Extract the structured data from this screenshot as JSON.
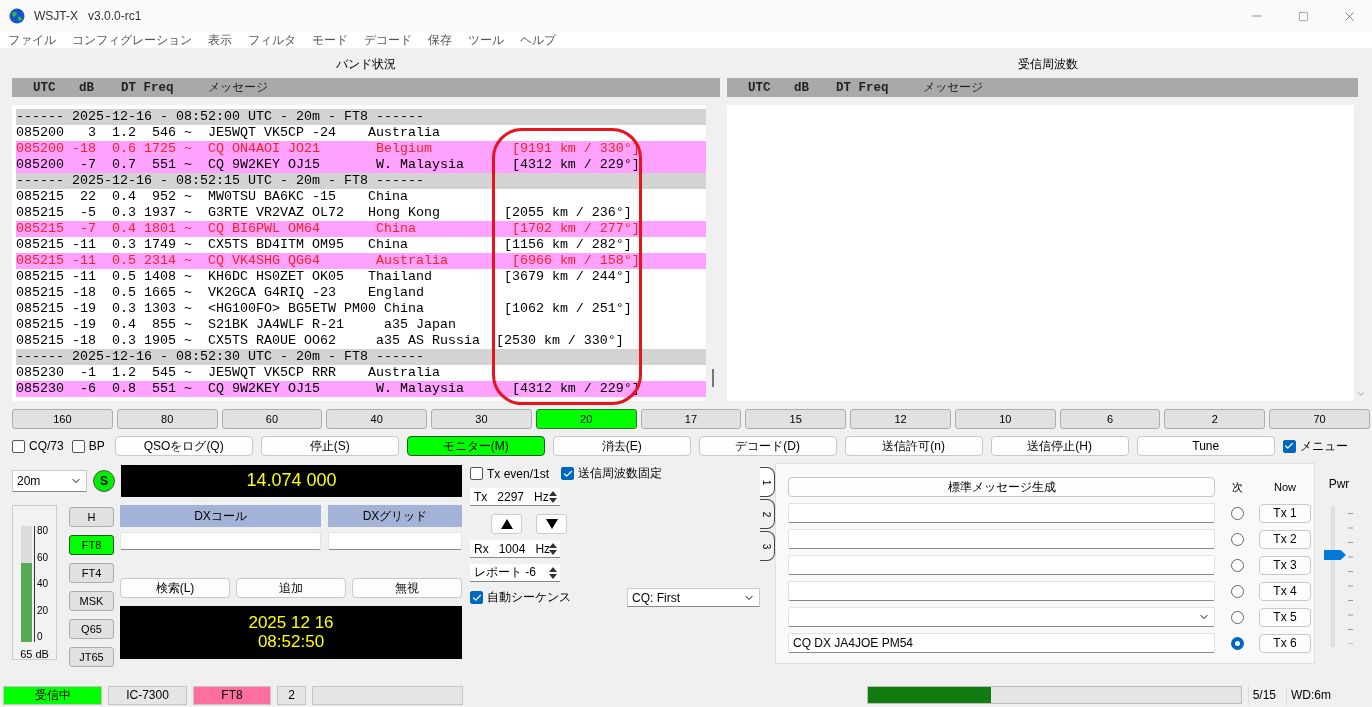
{
  "window": {
    "title": "WSJT-X   v3.0.0-rc1"
  },
  "menu": [
    "ファイル",
    "コンフィグレーション",
    "表示",
    "フィルタ",
    "モード",
    "デコード",
    "保存",
    "ツール",
    "ヘルプ"
  ],
  "band_activity": {
    "title": "バンド状況",
    "columns": [
      "UTC",
      "dB",
      "DT Freq",
      "メッセージ"
    ],
    "rows": [
      {
        "kind": "separator",
        "text": "------ 2025-12-16 - 08:52:00 UTC - 20m - FT8 ------"
      },
      {
        "kind": "decode",
        "text": "085200   3  1.2  546 ~  JE5WQT VK5CP -24    Australia",
        "highlighted": false,
        "alert": false
      },
      {
        "kind": "decode",
        "text": "085200 -18  0.6 1725 ~  CQ ON4AOI JO21       Belgium          [9191 km / 330°]",
        "highlighted": true,
        "alert": true
      },
      {
        "kind": "decode",
        "text": "085200  -7  0.7  551 ~  CQ 9W2KEY OJ15       W. Malaysia      [4312 km / 229°]",
        "highlighted": true,
        "alert": false
      },
      {
        "kind": "separator",
        "text": "------ 2025-12-16 - 08:52:15 UTC - 20m - FT8 ------"
      },
      {
        "kind": "decode",
        "text": "085215  22  0.4  952 ~  MW0TSU BA6KC -15    China",
        "highlighted": false,
        "alert": false
      },
      {
        "kind": "decode",
        "text": "085215  -5  0.3 1937 ~  G3RTE VR2VAZ OL72   Hong Kong        [2055 km / 236°]",
        "highlighted": false,
        "alert": false
      },
      {
        "kind": "decode",
        "text": "085215  -7  0.4 1801 ~  CQ BI6PWL OM64       China            [1702 km / 277°]",
        "highlighted": true,
        "alert": true
      },
      {
        "kind": "decode",
        "text": "085215 -11  0.3 1749 ~  CX5TS BD4ITM OM95   China            [1156 km / 282°]",
        "highlighted": false,
        "alert": false
      },
      {
        "kind": "decode",
        "text": "085215 -11  0.5 2314 ~  CQ VK4SHG QG64       Australia        [6966 km / 158°]",
        "highlighted": true,
        "alert": true
      },
      {
        "kind": "decode",
        "text": "085215 -11  0.5 1408 ~  KH6DC HS0ZET OK05   Thailand         [3679 km / 244°]",
        "highlighted": false,
        "alert": false
      },
      {
        "kind": "decode",
        "text": "085215 -18  0.5 1665 ~  VK2GCA G4RIQ -23    England",
        "highlighted": false,
        "alert": false
      },
      {
        "kind": "decode",
        "text": "085215 -19  0.3 1303 ~  <HG100FO> BG5ETW PM00 China          [1062 km / 251°]",
        "highlighted": false,
        "alert": false
      },
      {
        "kind": "decode",
        "text": "085215 -19  0.4  855 ~  S21BK JA4WLF R-21     a35 Japan",
        "highlighted": false,
        "alert": false
      },
      {
        "kind": "decode",
        "text": "085215 -18  0.3 1905 ~  CX5TS RA0UE OO62     a35 AS Russia  [2530 km / 330°]",
        "highlighted": false,
        "alert": false
      },
      {
        "kind": "separator",
        "text": "------ 2025-12-16 - 08:52:30 UTC - 20m - FT8 ------"
      },
      {
        "kind": "decode",
        "text": "085230  -1  1.2  545 ~  JE5WQT VK5CP RRR    Australia",
        "highlighted": false,
        "alert": false
      },
      {
        "kind": "decode",
        "text": "085230  -6  0.8  551 ~  CQ 9W2KEY OJ15       W. Malaysia      [4312 km / 229°]",
        "highlighted": true,
        "alert": false
      }
    ]
  },
  "rx_frequency": {
    "title": "受信周波数",
    "columns": [
      "UTC",
      "dB",
      "DT Freq",
      "メッセージ"
    ]
  },
  "bands": [
    {
      "label": "160",
      "selected": false
    },
    {
      "label": "80",
      "selected": false
    },
    {
      "label": "60",
      "selected": false
    },
    {
      "label": "40",
      "selected": false
    },
    {
      "label": "30",
      "selected": false
    },
    {
      "label": "20",
      "selected": true
    },
    {
      "label": "17",
      "selected": false
    },
    {
      "label": "15",
      "selected": false
    },
    {
      "label": "12",
      "selected": false
    },
    {
      "label": "10",
      "selected": false
    },
    {
      "label": "6",
      "selected": false
    },
    {
      "label": "2",
      "selected": false
    },
    {
      "label": "70",
      "selected": false
    }
  ],
  "controls": {
    "options": [
      {
        "label": "CQ/73",
        "checked": false
      },
      {
        "label": "BP",
        "checked": false
      }
    ],
    "buttons": [
      {
        "label": "QSOをログ(Q)",
        "active": false
      },
      {
        "label": "停止(S)",
        "active": false
      },
      {
        "label": "モニター(M)",
        "active": true
      },
      {
        "label": "消去(E)",
        "active": false
      },
      {
        "label": "デコード(D)",
        "active": false
      },
      {
        "label": "送信許可(n)",
        "active": false
      },
      {
        "label": "送信停止(H)",
        "active": false
      },
      {
        "label": "Tune",
        "active": false
      }
    ],
    "menu_toggle": {
      "label": "メニュー",
      "checked": true
    }
  },
  "band_select": {
    "value": "20m"
  },
  "sync_button": {
    "label": "S",
    "on": true
  },
  "frequency": "14.074 000",
  "meter": {
    "ticks": [
      "80",
      "60",
      "40",
      "20",
      "0"
    ],
    "level": 0.68,
    "reading": "65 dB"
  },
  "modes": [
    {
      "label": "H",
      "selected": false
    },
    {
      "label": "FT8",
      "selected": true
    },
    {
      "label": "FT4",
      "selected": false
    },
    {
      "label": "MSK",
      "selected": false
    },
    {
      "label": "Q65",
      "selected": false
    },
    {
      "label": "JT65",
      "selected": false
    }
  ],
  "dx": {
    "call_label": "DXコール",
    "grid_label": "DXグリッド"
  },
  "lookup_buttons": [
    "検索(L)",
    "追加",
    "無視"
  ],
  "clock": {
    "date": "2025 12 16",
    "time": "08:52:50"
  },
  "tx_options": [
    {
      "label": "Tx even/1st",
      "checked": false
    },
    {
      "label": "送信周波数固定",
      "checked": true
    }
  ],
  "tx_freq": {
    "prefix": "Tx",
    "value": "2297",
    "unit": "Hz"
  },
  "rx_freq": {
    "prefix": "Rx",
    "value": "1004",
    "unit": "Hz"
  },
  "report": "レポート -6",
  "auto_sequence": {
    "label": "自動シーケンス",
    "checked": true
  },
  "cq_mode": {
    "value": "CQ: First"
  },
  "message_tabs": [
    {
      "label": "1",
      "selected": true
    },
    {
      "label": "2",
      "selected": false
    },
    {
      "label": "3",
      "selected": false
    }
  ],
  "generate_button": "標準メッセージ生成",
  "next_header": "次",
  "now_header": "Now",
  "messages": [
    {
      "kind": "field",
      "selected": false,
      "button": "Tx 1"
    },
    {
      "kind": "field",
      "selected": false,
      "button": "Tx 2"
    },
    {
      "kind": "field",
      "selected": false,
      "button": "Tx 3"
    },
    {
      "kind": "field",
      "selected": false,
      "button": "Tx 4"
    },
    {
      "kind": "combo",
      "selected": false,
      "button": "Tx 5"
    },
    {
      "kind": "field",
      "value": "CQ DX JA4JOE PM54",
      "selected": true,
      "button": "Tx 6"
    }
  ],
  "power": {
    "label": "Pwr",
    "level": 0.67
  },
  "status_bar": {
    "segments": [
      {
        "text": "受信中",
        "color": "#00ff00"
      },
      {
        "text": "IC-7300",
        "color": "#e6e6e6"
      },
      {
        "text": "FT8",
        "color": "#ff6f9e"
      },
      {
        "text": "2",
        "color": "#e6e6e6"
      },
      {
        "color": "#e6e6e6"
      }
    ],
    "progress": {
      "level": 0.33
    },
    "period": "5/15",
    "watchdog": "WD:6m"
  }
}
